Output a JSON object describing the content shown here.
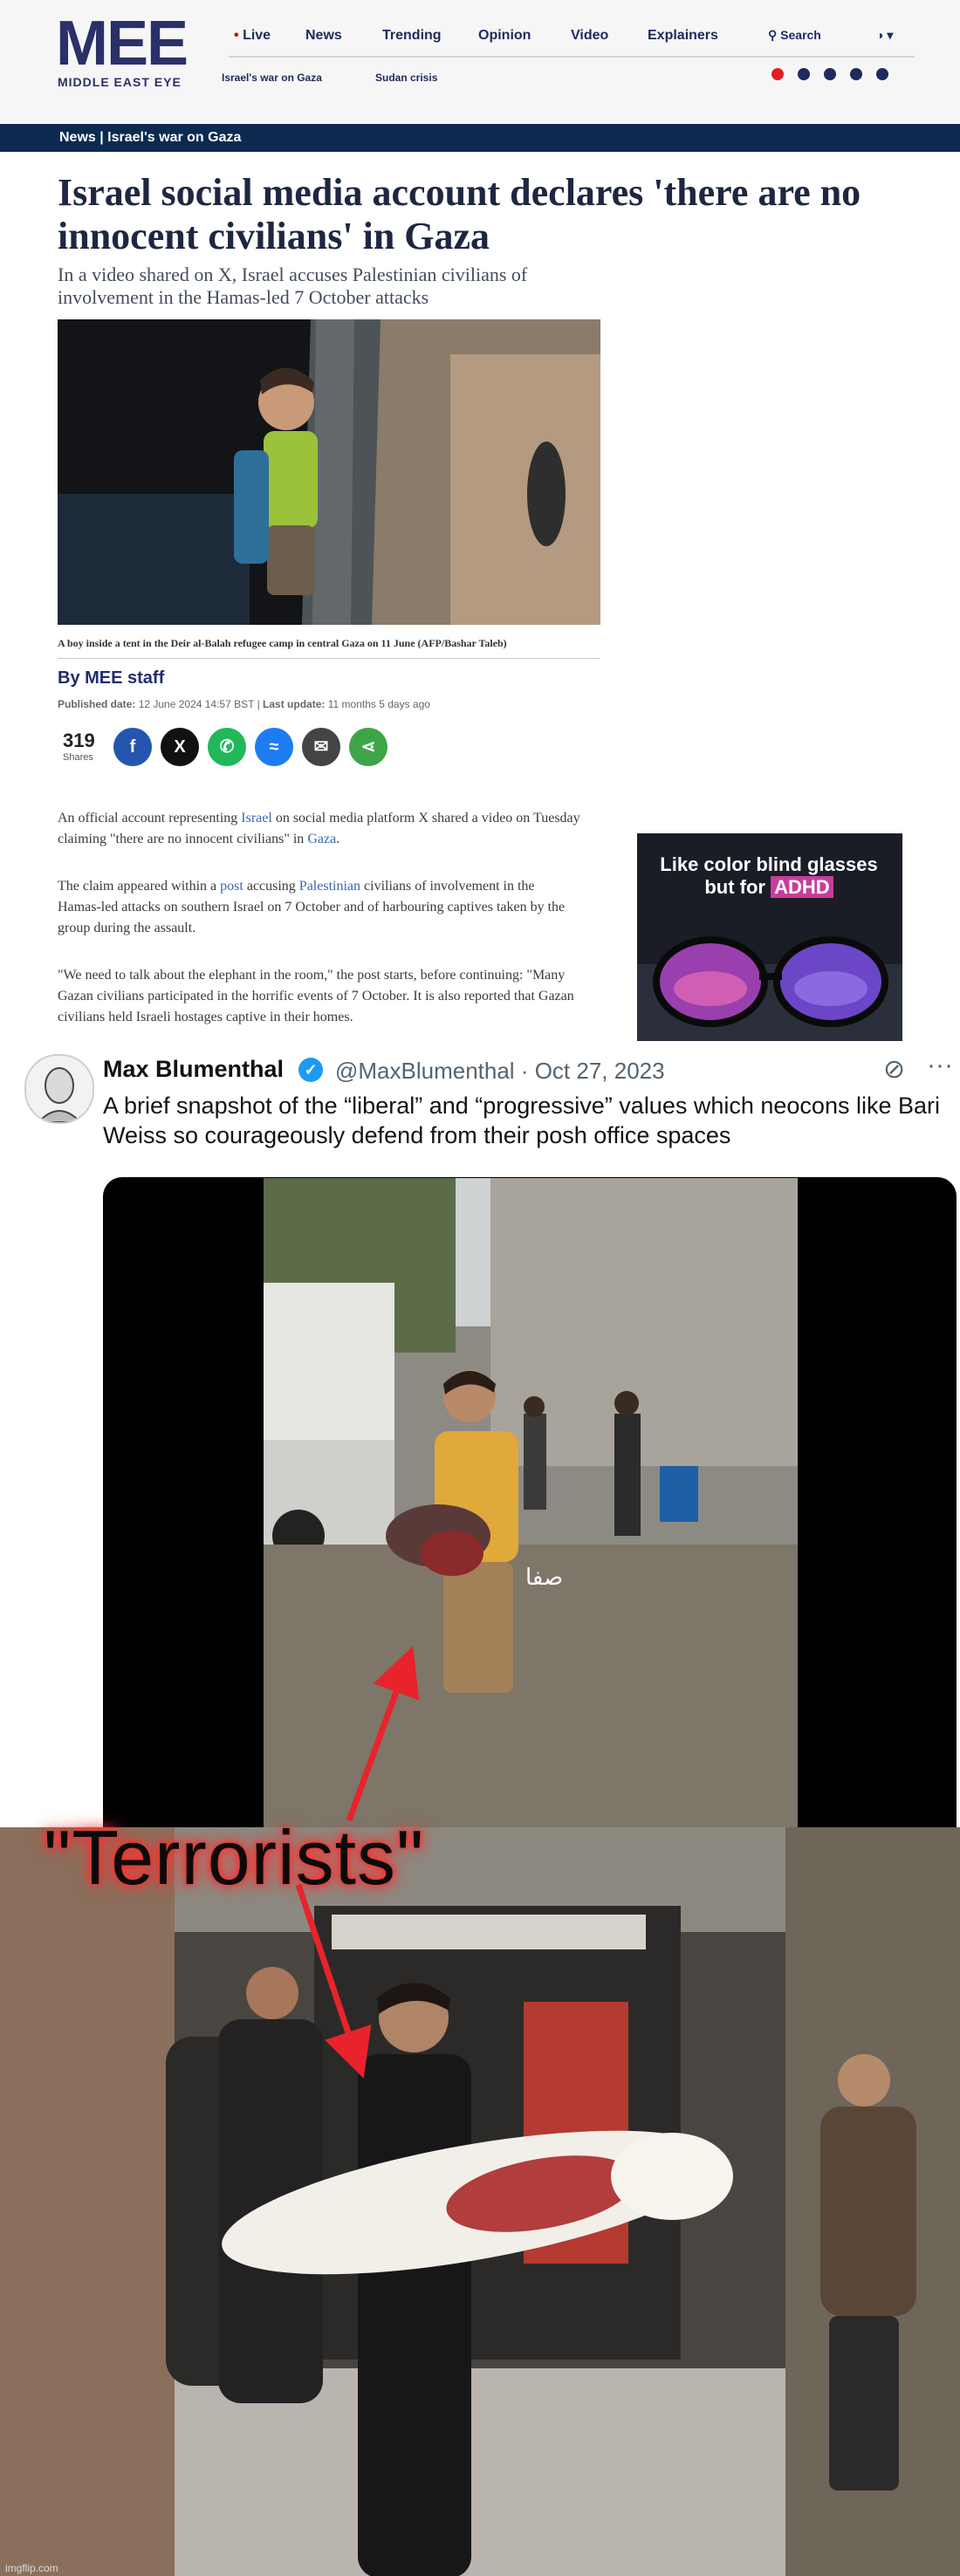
{
  "mee": {
    "logo": "MEE",
    "logo_sub": "MIDDLE EAST EYE",
    "nav": [
      "Live",
      "News",
      "Trending",
      "Opinion",
      "Video",
      "Explainers"
    ],
    "search_label": "Search",
    "subnav": [
      "Israel's war on Gaza",
      "Sudan crisis"
    ],
    "breadcrumb": "News | Israel's war on Gaza",
    "headline": "Israel social media account declares 'there are no innocent civilians' in Gaza",
    "standfirst": "In a video shared on X, Israel accuses Palestinian civilians of involvement in the Hamas-led 7 October attacks",
    "caption": "A boy inside a tent in the Deir al-Balah refugee camp in central Gaza on 11 June (AFP/Bashar Taleb)",
    "byline": "By MEE staff",
    "pubdate_label": "Published date:",
    "pubdate": "12 June 2024 14:57 BST",
    "update_label": "Last update:",
    "update": "11 months 5 days ago",
    "shares_count": "319",
    "shares_label": "Shares",
    "share_icons": [
      "facebook-icon",
      "x-icon",
      "whatsapp-icon",
      "messenger-icon",
      "email-icon",
      "share-icon"
    ],
    "p1_a": "An official account representing ",
    "p1_link1": "Israel",
    "p1_b": " on social media platform X shared a video on Tuesday claiming \"there are no innocent civilians\" in ",
    "p1_link2": "Gaza",
    "p1_c": ".",
    "p2_a": "The claim appeared within a ",
    "p2_link1": "post",
    "p2_b": " accusing ",
    "p2_link2": "Palestinian",
    "p2_c": " civilians of involvement in the Hamas-led attacks on southern Israel on 7 October and of harbouring captives taken by the group during the assault.",
    "p3": "\"We need to talk about the elephant in the room,\" the post starts, before continuing: \"Many Gazan civilians participated in the horrific events of 7 October. It is also reported that Gazan civilians held Israeli hostages captive in their homes.",
    "ad_line1": "Like color blind glasses",
    "ad_line2_a": "but for ",
    "ad_line2_hl": "ADHD",
    "colors": {
      "navy": "#0c2a4f",
      "brand": "#2a3068"
    }
  },
  "tweet": {
    "name": "Max Blumenthal",
    "handle_date": "@MaxBlumenthal · Oct 27, 2023",
    "text": "A brief snapshot of the “liberal” and “progressive” values which neocons like Bari Weiss so courageously defend from their posh office spaces",
    "more_icon": "more-icon",
    "grok_icon": "grok-icon",
    "video_logo": "صفا"
  },
  "meme": {
    "caption": "\"Terrorists\"",
    "watermark": "imgflip.com",
    "arrow_color": "#e8232b"
  }
}
